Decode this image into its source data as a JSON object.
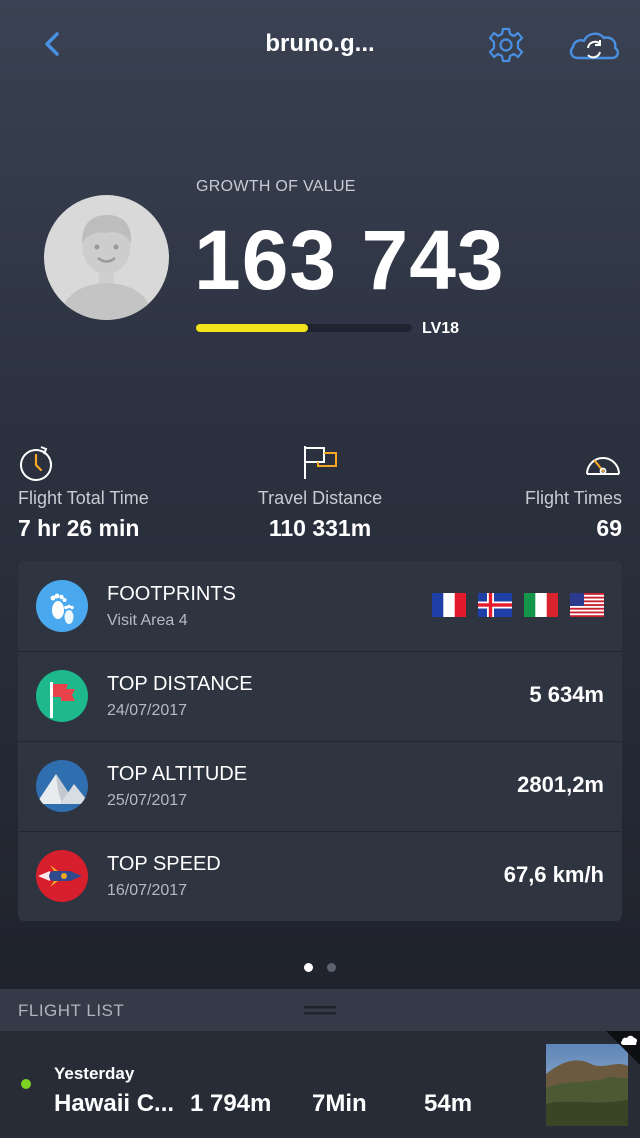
{
  "header": {
    "title": "bruno.g...",
    "back_icon": "back-icon",
    "settings_icon": "gear-icon",
    "sync_icon": "cloud-sync-icon"
  },
  "profile": {
    "growth_label": "GROWTH OF VALUE",
    "growth_value": "163 743",
    "level_progress": 0.52,
    "level": "LV18",
    "accent_color": "#f2e31b"
  },
  "stats": [
    {
      "icon": "stopwatch-icon",
      "label": "Flight Total Time",
      "value": "7 hr 26 min"
    },
    {
      "icon": "flag-icon",
      "label": "Travel Distance",
      "value": "110 331m"
    },
    {
      "icon": "speedometer-icon",
      "label": "Flight Times",
      "value": "69"
    }
  ],
  "records": [
    {
      "icon": "footprints-icon",
      "title": "FOOTPRINTS",
      "subtitle": "Visit Area 4",
      "flags": [
        "France",
        "Iceland",
        "Italy",
        "United States"
      ]
    },
    {
      "icon": "red-flag-icon",
      "title": "TOP DISTANCE",
      "subtitle": "24/07/2017",
      "value": "5 634m"
    },
    {
      "icon": "mountain-icon",
      "title": "TOP ALTITUDE",
      "subtitle": "25/07/2017",
      "value": "2801,2m"
    },
    {
      "icon": "rocket-icon",
      "title": "TOP SPEED",
      "subtitle": "16/07/2017",
      "value": "67,6 km/h"
    }
  ],
  "pager": {
    "pages": 2,
    "active": 1
  },
  "flight_list": {
    "title": "FLIGHT LIST",
    "items": [
      {
        "when": "Yesterday",
        "name": "Hawaii C...",
        "distance": "1 794m",
        "duration": "7Min",
        "altitude": "54m",
        "status_color": "#7ed321"
      }
    ]
  }
}
